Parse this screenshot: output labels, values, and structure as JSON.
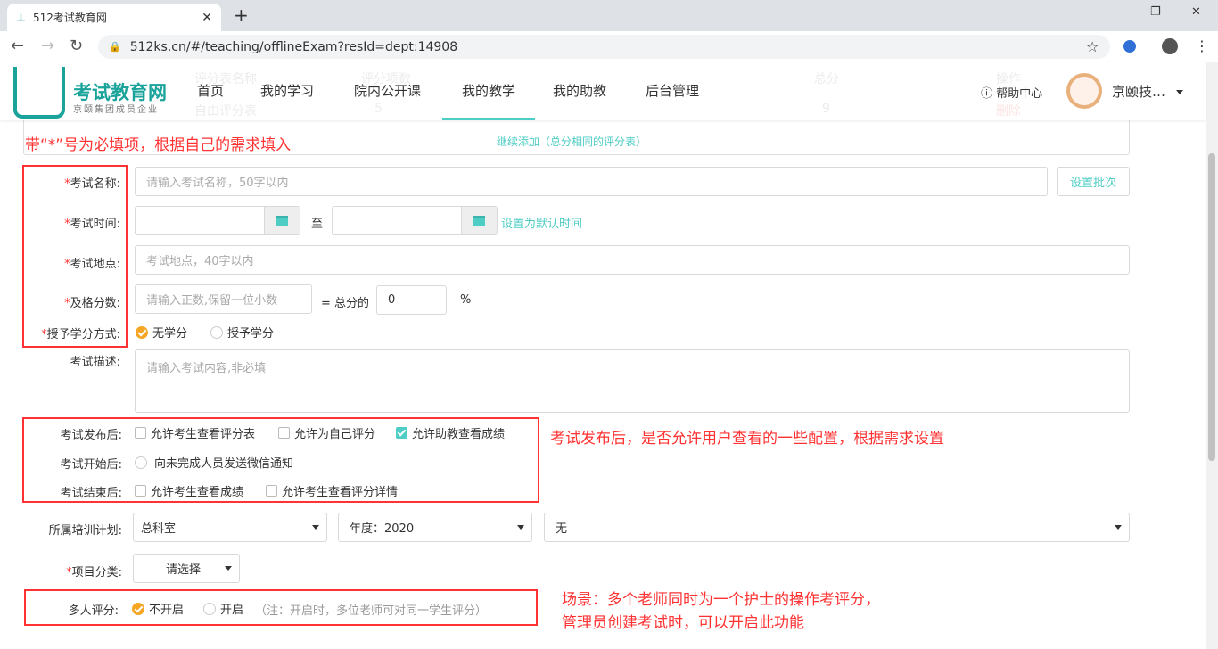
{
  "browser": {
    "tab_title": "512考试教育网",
    "url": "512ks.cn/#/teaching/offlineExam?resId=dept:14908"
  },
  "header": {
    "logo_title": "考试教育网",
    "logo_subtitle": "京颐集团成员企业",
    "nav": [
      "首页",
      "我的学习",
      "院内公开课",
      "我的教学",
      "我的助教",
      "后台管理"
    ],
    "active_nav": "我的教学",
    "help": "帮助中心",
    "user": "京颐技…"
  },
  "background_table": {
    "headers": [
      "评分表名称",
      "评分项数",
      "总分",
      "操作"
    ],
    "row": [
      "自由评分表",
      "5",
      "9",
      "删除"
    ],
    "add_link": "继续添加（总分相同的评分表）"
  },
  "annotations": {
    "required_note": "带“*”号为必填项，根据自己的需求填入",
    "publish_note": "考试发布后，是否允许用户查看的一些配置，根据需求设置",
    "scenario_line1": "场景：多个老师同时为一个护士的操作考评分，",
    "scenario_line2": "管理员创建考试时，可以开启此功能"
  },
  "form": {
    "name": {
      "label": "考试名称:",
      "placeholder": "请输入考试名称，50字以内",
      "batch_button": "设置批次"
    },
    "time": {
      "label": "考试时间:",
      "to": "至",
      "default_link": "设置为默认时间"
    },
    "place": {
      "label": "考试地点:",
      "placeholder": "考试地点，40字以内"
    },
    "pass": {
      "label": "及格分数:",
      "placeholder": "请输入正数,保留一位小数",
      "equals": "= 总分的",
      "percent_value": "0",
      "percent": "%"
    },
    "credit": {
      "label": "授予学分方式:",
      "options": [
        "无学分",
        "授予学分"
      ],
      "selected": "无学分"
    },
    "desc": {
      "label": "考试描述:",
      "placeholder": "请输入考试内容,非必填"
    },
    "after_publish": {
      "label": "考试发布后:",
      "options": [
        {
          "label": "允许考生查看评分表",
          "checked": false
        },
        {
          "label": "允许为自己评分",
          "checked": false
        },
        {
          "label": "允许助教查看成绩",
          "checked": true
        }
      ]
    },
    "after_start": {
      "label": "考试开始后:",
      "option": "向未完成人员发送微信通知",
      "checked": false
    },
    "after_end": {
      "label": "考试结束后:",
      "options": [
        {
          "label": "允许考生查看成绩",
          "checked": false
        },
        {
          "label": "允许考生查看评分详情",
          "checked": false
        }
      ]
    },
    "plan": {
      "label": "所属培训计划:",
      "dept": "总科室",
      "year": "年度：2020",
      "plan": "无"
    },
    "category": {
      "label": "项目分类:",
      "value": "请选择"
    },
    "multi": {
      "label": "多人评分:",
      "options": [
        "不开启",
        "开启"
      ],
      "selected": "不开启",
      "hint": "（注：开启时，多位老师可对同一学生评分）"
    }
  },
  "colors": {
    "accent": "#4ecdc4",
    "required": "#ff3333",
    "radio": "#f5a623"
  }
}
